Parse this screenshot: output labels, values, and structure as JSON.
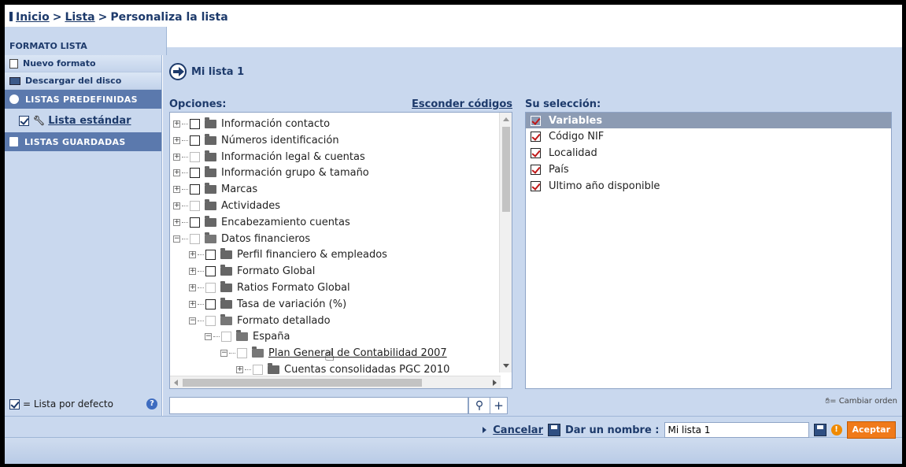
{
  "breadcrumb": {
    "home": "Inicio",
    "sep1": ">",
    "list": "Lista",
    "sep2": ">",
    "current": "Personaliza la lista"
  },
  "tabs": {
    "active": "FORMATO LISTA"
  },
  "sidebar": {
    "new_format": "Nuevo formato",
    "download": "Descargar del disco",
    "predefined": "LISTAS PREDEFINIDAS",
    "standard_list": "Lista estándar",
    "saved": "LISTAS GUARDADAS",
    "legend": "= Lista por defecto",
    "help": "?"
  },
  "main": {
    "title": "Mi lista 1",
    "options_label": "Opciones:",
    "hide_codes": "Esconder códigos",
    "selection_label": "Su selección:",
    "search_placeholder": "",
    "search_icon": "⚲",
    "plus": "+",
    "reorder_hint": "= Cambiar orden"
  },
  "tree": [
    {
      "label": "Información contacto",
      "level": 0,
      "pm": "+",
      "cb": "dark",
      "open": false,
      "link": false
    },
    {
      "label": "Números identificación",
      "level": 0,
      "pm": "+",
      "cb": "dark",
      "open": false,
      "link": false
    },
    {
      "label": "Información legal & cuentas",
      "level": 0,
      "pm": "+",
      "cb": "light",
      "open": false,
      "link": false
    },
    {
      "label": "Información grupo & tamaño",
      "level": 0,
      "pm": "+",
      "cb": "dark",
      "open": false,
      "link": false
    },
    {
      "label": "Marcas",
      "level": 0,
      "pm": "+",
      "cb": "dark",
      "open": false,
      "link": false
    },
    {
      "label": "Actividades",
      "level": 0,
      "pm": "+",
      "cb": "light",
      "open": false,
      "link": false
    },
    {
      "label": "Encabezamiento cuentas",
      "level": 0,
      "pm": "+",
      "cb": "dark",
      "open": false,
      "link": false
    },
    {
      "label": "Datos financieros",
      "level": 0,
      "pm": "−",
      "cb": "light",
      "open": true,
      "link": false
    },
    {
      "label": "Perfil financiero & empleados",
      "level": 1,
      "pm": "+",
      "cb": "dark",
      "open": false,
      "link": false
    },
    {
      "label": "Formato Global",
      "level": 1,
      "pm": "+",
      "cb": "dark",
      "open": false,
      "link": false
    },
    {
      "label": "Ratios Formato Global",
      "level": 1,
      "pm": "+",
      "cb": "light",
      "open": false,
      "link": false
    },
    {
      "label": "Tasa de variación (%)",
      "level": 1,
      "pm": "+",
      "cb": "dark",
      "open": false,
      "link": false
    },
    {
      "label": "Formato detallado",
      "level": 1,
      "pm": "−",
      "cb": "light",
      "open": true,
      "link": false
    },
    {
      "label": "España",
      "level": 2,
      "pm": "−",
      "cb": "light",
      "open": true,
      "link": false
    },
    {
      "label": "Plan General de Contabilidad 2007",
      "level": 3,
      "pm": "−",
      "cb": "light",
      "open": true,
      "link": true
    },
    {
      "label": "Cuentas consolidadas PGC 2010",
      "level": 4,
      "pm": "+",
      "cb": "light",
      "open": false,
      "link": false
    }
  ],
  "selection": {
    "header": "Variables",
    "items": [
      "Código NIF",
      "Localidad",
      "País",
      "Ultimo año disponible"
    ]
  },
  "footer": {
    "cancel": "Cancelar",
    "name_label": "Dar un nombre :",
    "name_value": "Mi lista 1",
    "warn": "!",
    "accept": "Aceptar"
  },
  "colors": {
    "accent": "#1d3a6b",
    "panel": "#c9d8ee",
    "section": "#5b79ad",
    "accept": "#f07a1a",
    "check_red": "#c01818"
  }
}
